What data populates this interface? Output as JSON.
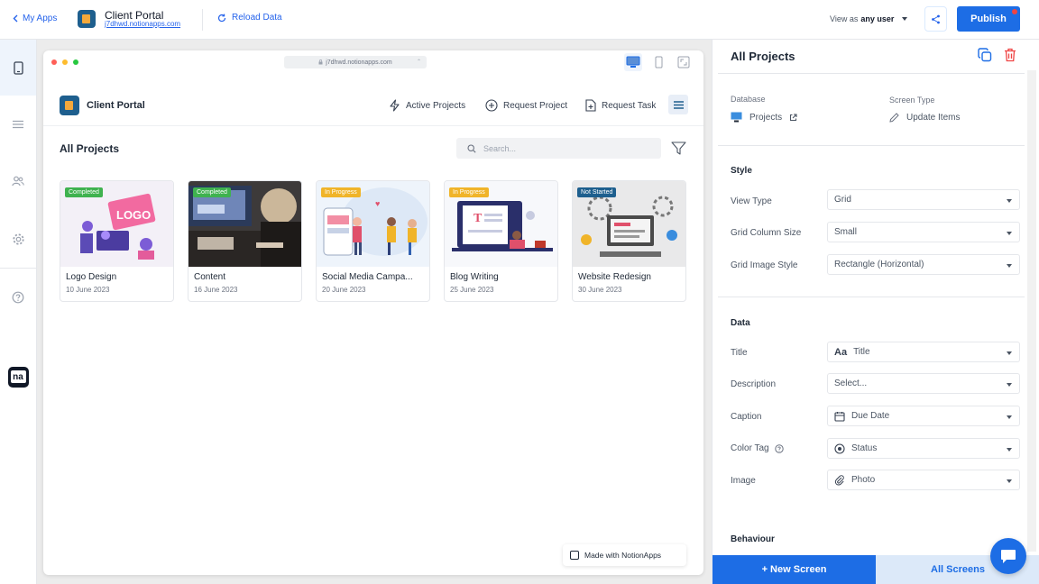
{
  "topbar": {
    "back_label": "My Apps",
    "app_title": "Client Portal",
    "app_url": "j7dhwd.notionapps.com",
    "reload_label": "Reload Data",
    "view_as_prefix": "View as",
    "view_as_value": "any user",
    "publish_label": "Publish",
    "publish_color": "#1d6de5"
  },
  "left_rail": {
    "items": [
      {
        "icon": "mobile-icon"
      },
      {
        "icon": "list-icon"
      },
      {
        "icon": "users-icon"
      },
      {
        "icon": "gear-icon"
      },
      {
        "icon": "help-icon"
      }
    ],
    "brand_logo_text": "na"
  },
  "browser": {
    "url": "j7dhwd.notionapps.com"
  },
  "preview": {
    "app_title": "Client Portal",
    "nav": [
      {
        "label": "Active Projects",
        "icon": "bolt-icon"
      },
      {
        "label": "Request Project",
        "icon": "plus-circle-icon"
      },
      {
        "label": "Request Task",
        "icon": "file-plus-icon"
      }
    ],
    "page_title": "All Projects",
    "search_placeholder": "Search...",
    "cards": [
      {
        "title": "Logo Design",
        "date": "10 June 2023",
        "status": "Completed",
        "status_color": "#3fb24f"
      },
      {
        "title": "Content",
        "date": "16 June 2023",
        "status": "Completed",
        "status_color": "#3fb24f"
      },
      {
        "title": "Social Media Campa...",
        "date": "20 June 2023",
        "status": "In Progress",
        "status_color": "#f0b429"
      },
      {
        "title": "Blog Writing",
        "date": "25 June 2023",
        "status": "In Progress",
        "status_color": "#f0b429"
      },
      {
        "title": "Website Redesign",
        "date": "30 June 2023",
        "status": "Not Started",
        "status_color": "#1e5f8e"
      }
    ],
    "made_with": "Made with NotionApps"
  },
  "panel": {
    "title": "All Projects",
    "database_label": "Database",
    "database_value": "Projects",
    "screen_type_label": "Screen Type",
    "screen_type_value": "Update Items",
    "style_heading": "Style",
    "style_rows": [
      {
        "label": "View Type",
        "value": "Grid"
      },
      {
        "label": "Grid Column Size",
        "value": "Small"
      },
      {
        "label": "Grid Image Style",
        "value": "Rectangle (Horizontal)"
      }
    ],
    "data_heading": "Data",
    "data_rows": [
      {
        "label": "Title",
        "value": "Title",
        "icon": "text-aa-icon"
      },
      {
        "label": "Description",
        "value": "Select...",
        "icon": ""
      },
      {
        "label": "Caption",
        "value": "Due Date",
        "icon": "calendar-icon"
      },
      {
        "label": "Color Tag",
        "value": "Status",
        "icon": "status-icon"
      },
      {
        "label": "Image",
        "value": "Photo",
        "icon": "paperclip-icon"
      }
    ],
    "behaviour_heading": "Behaviour",
    "new_screen_label": "+ New Screen",
    "all_screens_label": "All Screens"
  }
}
